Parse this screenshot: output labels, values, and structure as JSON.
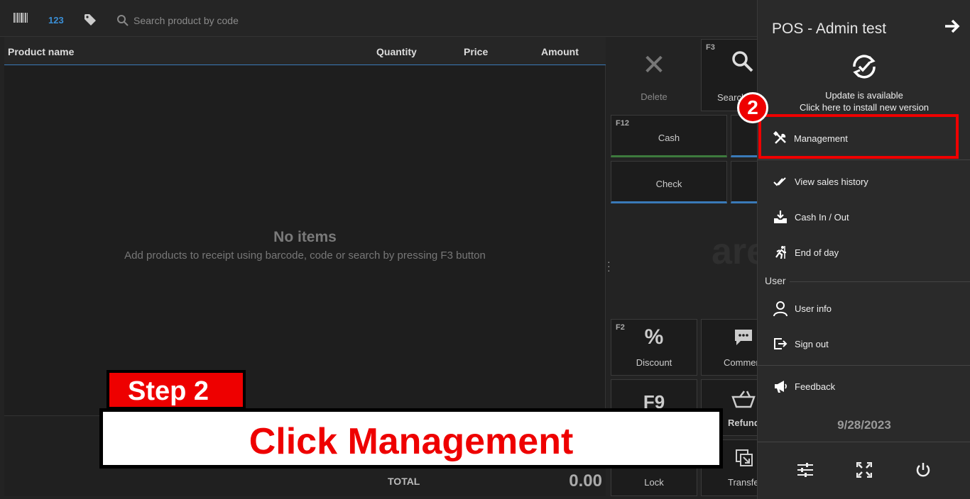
{
  "topbar": {
    "barcode_icon": "barcode-icon",
    "code_label": "123",
    "tag_icon": "tag-icon",
    "search_placeholder": "Search product by code"
  },
  "receipt": {
    "columns": [
      "Product name",
      "Quantity",
      "Price",
      "Amount"
    ],
    "empty_title": "No items",
    "empty_subtitle": "Add products to receipt using barcode, code or search by pressing F3 button",
    "total_label": "TOTAL",
    "total_value": "0.00"
  },
  "buttons": {
    "delete": "Delete",
    "search_key": "F3",
    "search": "Search",
    "cash_key": "F12",
    "cash": "Cash",
    "check": "Check",
    "ghost": "are",
    "discount_key": "F2",
    "discount": "Discount",
    "comment": "Comment",
    "f9": "F9",
    "refund": "Refund",
    "lock": "Lock",
    "transfer": "Transfer"
  },
  "menu": {
    "title": "POS - Admin test",
    "update_line1": "Update is available",
    "update_line2": "Click here to install new version",
    "items": [
      {
        "label": "Management",
        "icon": "tools-icon"
      },
      {
        "label": "View sales history",
        "icon": "double-check-icon"
      },
      {
        "label": "Cash In / Out",
        "icon": "download-tray-icon"
      },
      {
        "label": "End of day",
        "icon": "runner-icon"
      }
    ],
    "user_header": "User",
    "user_items": [
      {
        "label": "User info",
        "icon": "user-icon"
      },
      {
        "label": "Sign out",
        "icon": "sign-out-icon"
      }
    ],
    "feedback": "Feedback",
    "date": "9/28/2023"
  },
  "overlay": {
    "badge": "2",
    "step": "Step 2",
    "instruction": "Click Management",
    "highlight_color": "#e00000"
  }
}
